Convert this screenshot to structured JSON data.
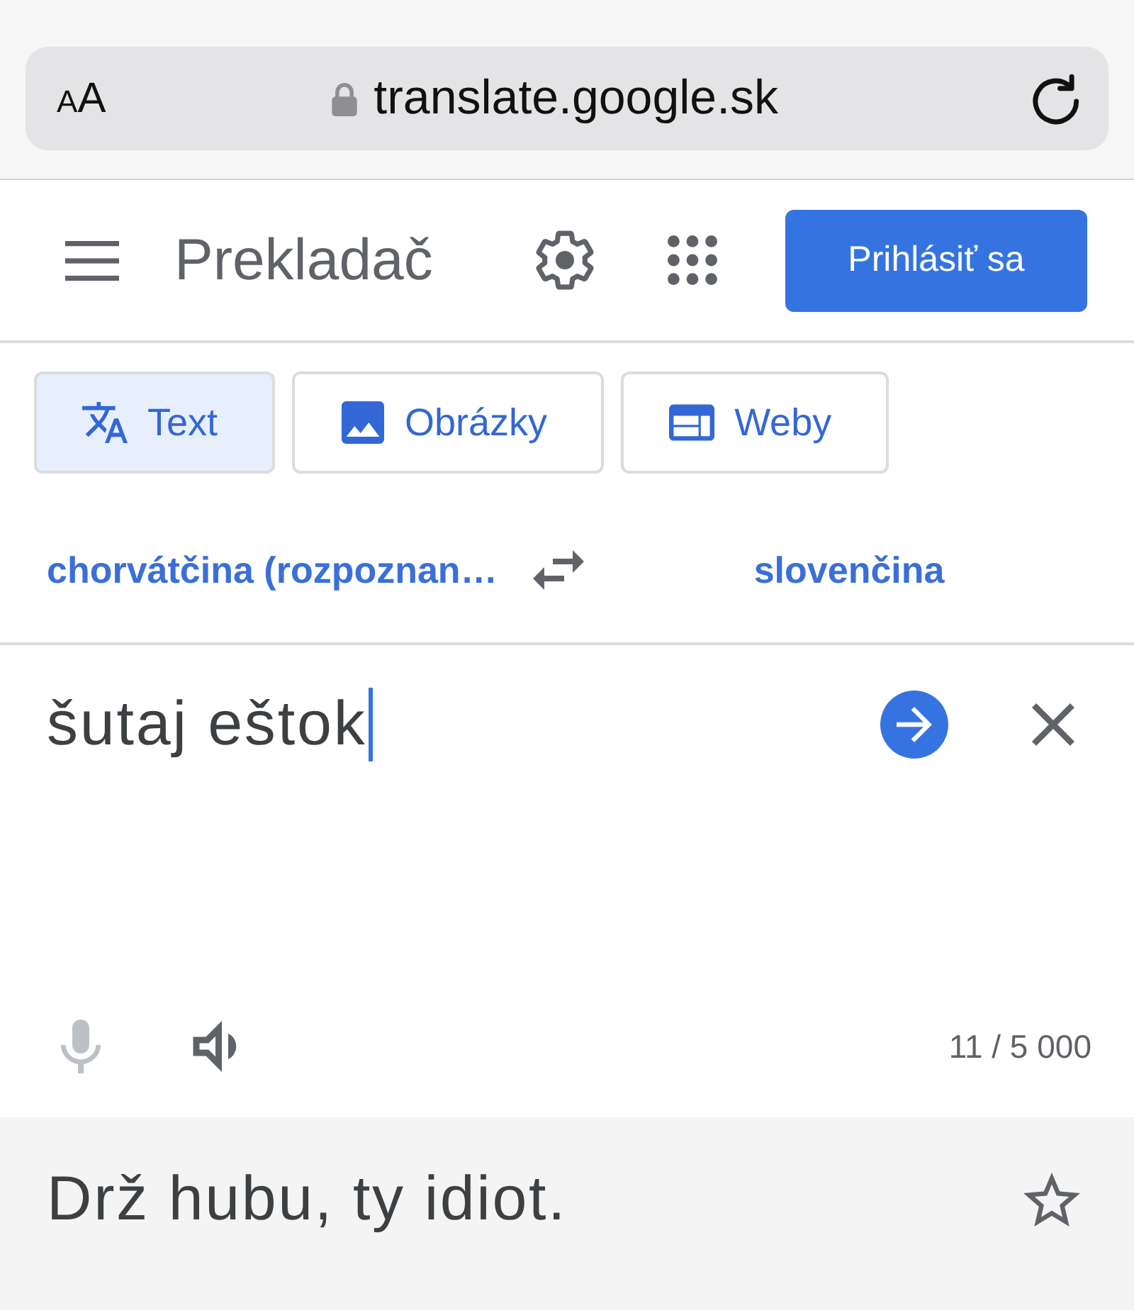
{
  "browser": {
    "text_size_button": "AA",
    "secure": true,
    "url": "translate.google.sk"
  },
  "header": {
    "title": "Prekladač",
    "sign_in_button": "Prihlásiť sa"
  },
  "tabs": [
    {
      "kind": "text",
      "label": "Text",
      "selected": true
    },
    {
      "kind": "images",
      "label": "Obrázky",
      "selected": false
    },
    {
      "kind": "websites",
      "label": "Weby",
      "selected": false
    }
  ],
  "languages": {
    "source": "chorvátčina (rozpoznan…",
    "target": "slovenčina"
  },
  "input": {
    "value": "šutaj eštok",
    "microphone": {
      "disabled": true
    },
    "counter": "11 / 5 000"
  },
  "output": {
    "text": "Drž hubu, ty idiot.",
    "saved": false
  }
}
